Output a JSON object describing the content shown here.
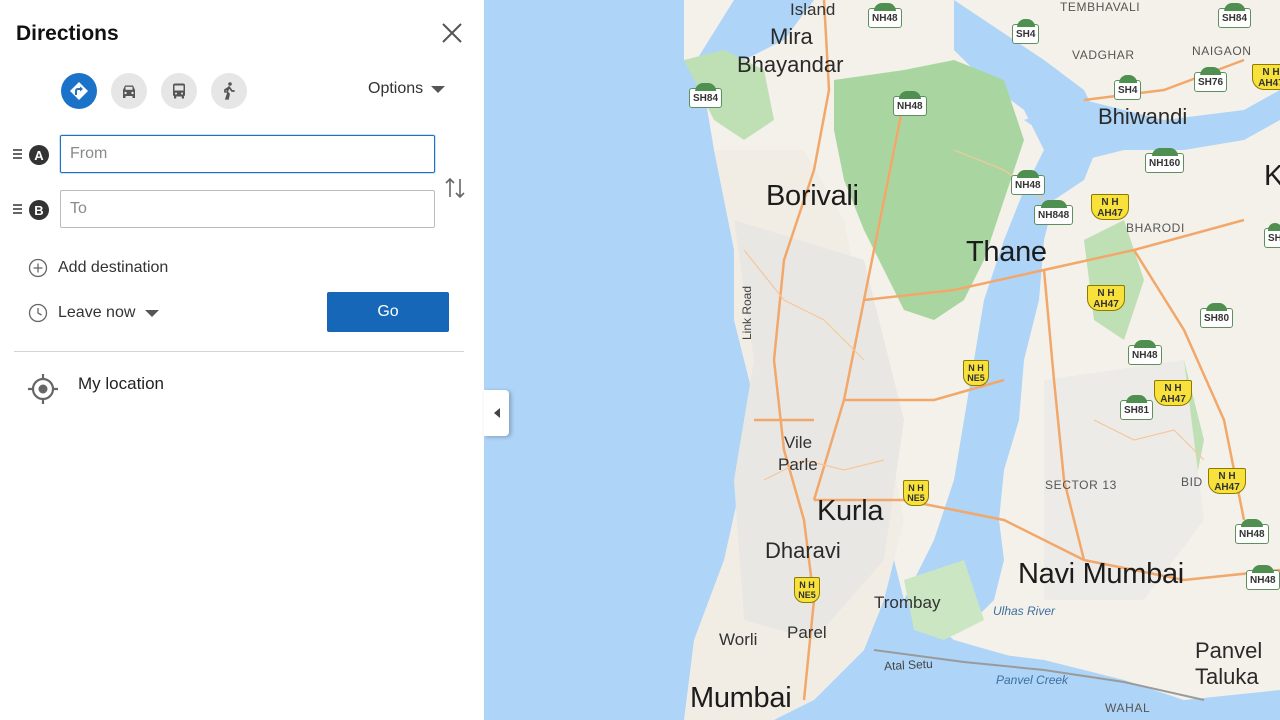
{
  "panel": {
    "title": "Directions",
    "options_label": "Options",
    "modes": [
      {
        "name": "directions-mode",
        "icon": "turn-arrow-icon",
        "active": true
      },
      {
        "name": "driving-mode",
        "icon": "car-icon",
        "active": false
      },
      {
        "name": "transit-mode",
        "icon": "bus-icon",
        "active": false
      },
      {
        "name": "walking-mode",
        "icon": "walking-person-icon",
        "active": false
      }
    ],
    "waypoints": [
      {
        "badge": "A",
        "placeholder": "From",
        "value": ""
      },
      {
        "badge": "B",
        "placeholder": "To",
        "value": ""
      }
    ],
    "add_destination": "Add destination",
    "leave_now": "Leave now",
    "go_label": "Go",
    "my_location": "My location",
    "accent_color": "#1767b8"
  },
  "map": {
    "colors": {
      "water": "#aed4f8",
      "land": "#f4f1ea",
      "forest": "#a9d6a0",
      "road": "#f2a86a",
      "urban": "#e8e6e2"
    },
    "labels": {
      "island": "Island",
      "tembhavali": "TEMBHAVALI",
      "mira": "Mira",
      "bhayandar": "Bhayandar",
      "vadghar": "VADGHAR",
      "naigaon": "NAIGAON",
      "bhiwandi": "Bhiwandi",
      "borivali": "Borivali",
      "bharodi": "BHARODI",
      "thane": "Thane",
      "link_road": "Link Road",
      "vile": "Vile",
      "parle": "Parle",
      "sector_13": "SECTOR 13",
      "bid": "BID",
      "kurla": "Kurla",
      "dharavi": "Dharavi",
      "navi_mumbai": "Navi Mumbai",
      "trombay": "Trombay",
      "ulhas_river": "Ulhas River",
      "worli": "Worli",
      "parel": "Parel",
      "panvel": "Panvel",
      "taluka": "Taluka",
      "atal_setu": "Atal Setu",
      "panvel_creek": "Panvel Creek",
      "mumbai": "Mumbai",
      "wahal": "WAHAL",
      "k_edge": "K"
    },
    "shields": {
      "nh48_a": "NH48",
      "nh48_b": "NH48",
      "nh48_c": "NH48",
      "nh48_d": "NH48",
      "nh48_e": "NH48",
      "nh48_f": "NH48",
      "sh4_a": "SH4",
      "sh4_b": "SH4",
      "sh84_a": "SH84",
      "sh84_b": "SH84",
      "sh76": "SH76",
      "nh160": "NH160",
      "nh848": "NH848",
      "sh80": "SH80",
      "sh81": "SH81",
      "sh_edge": "SH"
    },
    "ah_shields": {
      "a": "AH47",
      "b": "AH47",
      "c": "AH47",
      "d": "AH47",
      "e": "AH47"
    },
    "ne_shields": {
      "a": "NE5",
      "b": "NE5",
      "c": "NE5"
    },
    "nh_prefix": "N H"
  }
}
